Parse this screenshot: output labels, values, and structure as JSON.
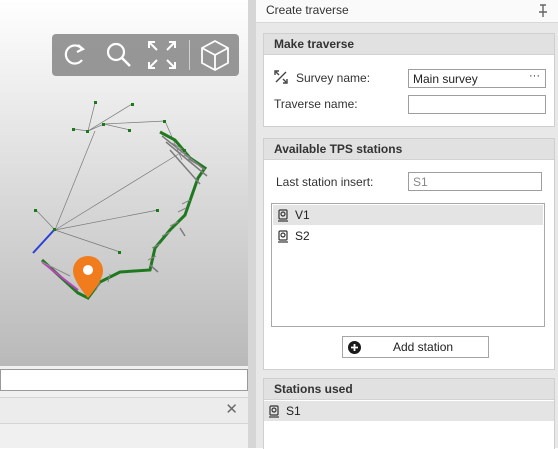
{
  "viewport": {
    "toolbar": [
      {
        "name": "reset-view-icon"
      },
      {
        "name": "zoom-icon"
      },
      {
        "name": "fit-extent-icon"
      },
      {
        "name": "3d-view-icon",
        "label": "3D"
      }
    ],
    "accent_colors": {
      "marker": "#f07c1e",
      "blue_line": "#2a3fd6",
      "magenta_line": "#c040c0",
      "point": "#1a7a1a"
    }
  },
  "left_bottom": {
    "input_value": "",
    "close_label": "✕"
  },
  "panel": {
    "title": "Create traverse",
    "pin_label": "⁠⊥",
    "make_traverse": {
      "heading": "Make traverse",
      "survey_label": "Survey name:",
      "survey_value": "Main survey",
      "survey_button": "···",
      "traverse_label": "Traverse name:",
      "traverse_value": ""
    },
    "available": {
      "heading": "Available TPS stations",
      "last_station_label": "Last station insert:",
      "last_station_value": "S1",
      "stations": [
        "V1",
        "S2"
      ],
      "add_button": "Add station"
    },
    "used": {
      "heading": "Stations used",
      "stations": [
        "S1"
      ]
    }
  }
}
